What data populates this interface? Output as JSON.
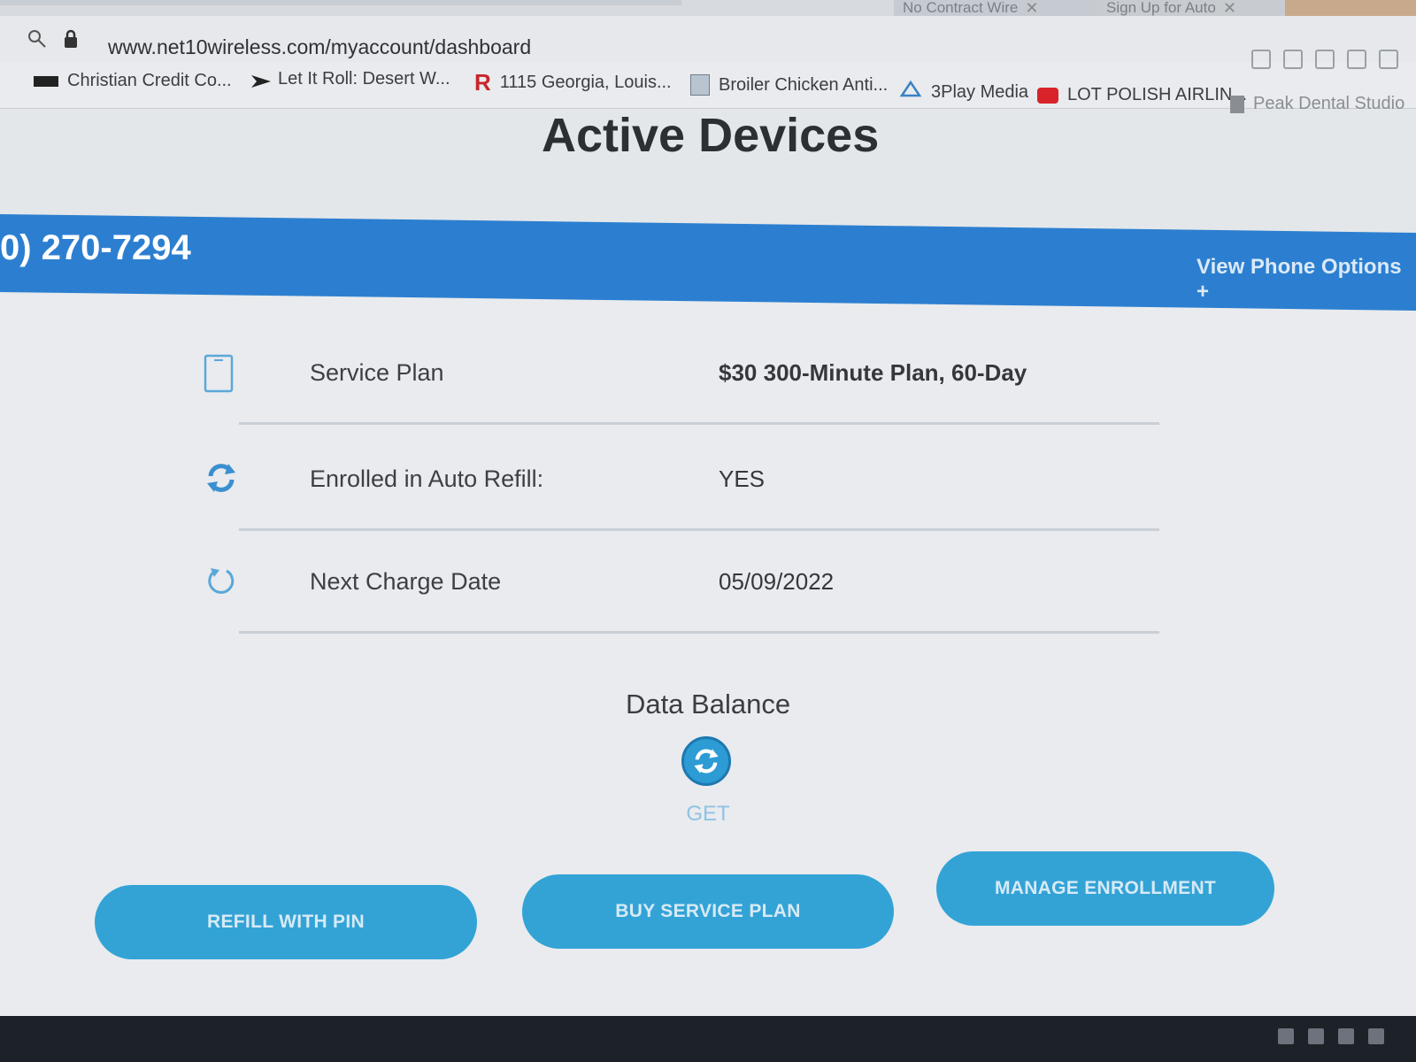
{
  "browser": {
    "tabs": [
      {
        "label": "No Contract Wire",
        "close": "✕"
      },
      {
        "label": "Sign Up for Auto",
        "close": "✕"
      }
    ],
    "url": "www.net10wireless.com/myaccount/dashboard",
    "bookmarks": [
      {
        "label": "Christian Credit Co..."
      },
      {
        "label": "Let It Roll: Desert W..."
      },
      {
        "label": "1115 Georgia, Louis..."
      },
      {
        "label": "Broiler Chicken Anti..."
      },
      {
        "label": "3Play Media"
      },
      {
        "label": "LOT POLISH AIRLIN..."
      },
      {
        "label": "Peak Dental Studio"
      }
    ]
  },
  "page": {
    "title": "Active Devices",
    "phone_number": "0) 270-7294",
    "phone_options": "View Phone Options +",
    "rows": [
      {
        "icon": "phone-icon",
        "label": "Service Plan",
        "value": "$30 300-Minute Plan, 60-Day"
      },
      {
        "icon": "refresh-icon",
        "label": "Enrolled in Auto Refill:",
        "value": "YES"
      },
      {
        "icon": "reload-icon",
        "label": "Next Charge Date",
        "value": "05/09/2022"
      }
    ],
    "data_balance": {
      "title": "Data Balance",
      "button": "GET"
    },
    "buttons": {
      "refill": "REFILL WITH PIN",
      "buy": "BUY SERVICE PLAN",
      "manage": "MANAGE ENROLLMENT"
    }
  },
  "colors": {
    "accent": "#2c7fd0",
    "button": "#33a3d6"
  }
}
